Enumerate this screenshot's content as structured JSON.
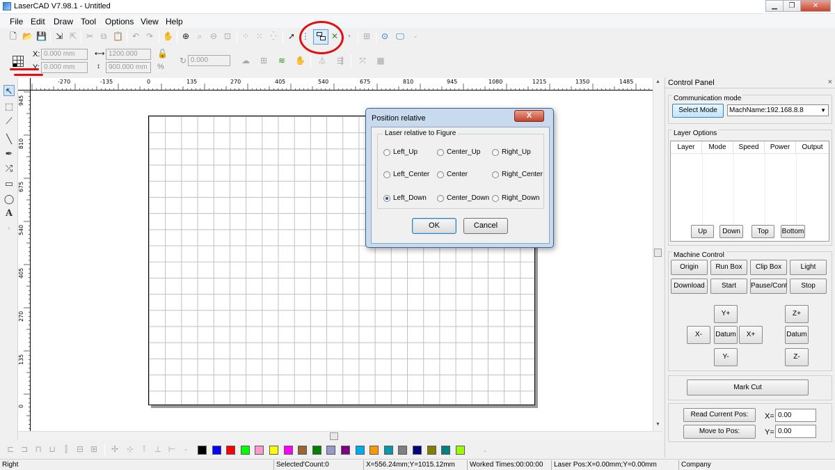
{
  "window": {
    "title": "LaserCAD V7.98.1 - Untitled"
  },
  "menu": [
    {
      "label": "File",
      "key": "F"
    },
    {
      "label": "Edit",
      "key": "E"
    },
    {
      "label": "Draw",
      "key": "D"
    },
    {
      "label": "Tool",
      "key": "T"
    },
    {
      "label": "Options",
      "key": "O"
    },
    {
      "label": "View",
      "key": "V"
    },
    {
      "label": "Help",
      "key": "H"
    }
  ],
  "coords": {
    "x_label": "X:",
    "y_label": "Y:",
    "x_value": "0.000 mm",
    "y_value": "0.000 mm",
    "width_value": "1200.000 mm",
    "height_value": "900.000 mm",
    "rotate_value": "0.000",
    "percent_symbol": "%"
  },
  "ruler": {
    "horizontal": [
      "-270",
      "-135",
      "0",
      "135",
      "270",
      "405",
      "540",
      "675",
      "810",
      "945",
      "1080",
      "1215",
      "1350",
      "1485"
    ],
    "vertical": [
      "945",
      "810",
      "675",
      "540",
      "405",
      "270",
      "135",
      "0"
    ]
  },
  "dialog": {
    "title": "Position relative",
    "close": "X",
    "group_label": "Laser relative to Figure",
    "options": [
      {
        "label": "Left_Up",
        "selected": false
      },
      {
        "label": "Center_Up",
        "selected": false
      },
      {
        "label": "Right_Up",
        "selected": false
      },
      {
        "label": "Left_Center",
        "selected": false
      },
      {
        "label": "Center",
        "selected": false
      },
      {
        "label": "Right_Center",
        "selected": false
      },
      {
        "label": "Left_Down",
        "selected": true
      },
      {
        "label": "Center_Down",
        "selected": false
      },
      {
        "label": "Right_Down",
        "selected": false
      }
    ],
    "ok": "OK",
    "cancel": "Cancel"
  },
  "control_panel": {
    "title": "Control Panel",
    "close": "×",
    "comm_label": "Communication mode",
    "select_mode": "Select Mode",
    "machine_name": "MachName:192.168.8.8",
    "layer_label": "Layer Options",
    "layer_columns": [
      "Layer",
      "Mode",
      "Speed",
      "Power",
      "Output"
    ],
    "layer_buttons": [
      "Up",
      "Down",
      "Top",
      "Bottom"
    ],
    "machine_label": "Machine Control",
    "machine_row1": [
      "Origin",
      "Run Box",
      "Clip Box",
      "Light"
    ],
    "machine_row2": [
      "Download",
      "Start",
      "Pause/Continue",
      "Stop"
    ],
    "jog": {
      "y_plus": "Y+",
      "x_minus": "X-",
      "datum": "Datum",
      "x_plus": "X+",
      "y_minus": "Y-",
      "z_plus": "Z+",
      "z_datum": "Datum",
      "z_minus": "Z-"
    },
    "mark_cut": "Mark Cut",
    "read_pos": "Read Current Pos:",
    "move_pos": "Move to Pos:",
    "x_label": "X=",
    "y_label": "Y=",
    "x_value": "0.00",
    "y_value": "0.00"
  },
  "palette": [
    "#000000",
    "#0000ff",
    "#ff0000",
    "#00ff00",
    "#ff99cc",
    "#ffff00",
    "#ff00ff",
    "#996633",
    "#008000",
    "#9999cc",
    "#800080",
    "#00aaee",
    "#ff9900",
    "#0099aa",
    "#808080",
    "#000080",
    "#808000",
    "#008080",
    "#99ff00"
  ],
  "status": {
    "mode": "Right",
    "selected": "Selected'Count:0",
    "cursor": "X=556.24mm;Y=1015.12mm",
    "worked": "Worked Times:00:00:00",
    "laser_pos": "Laser Pos:X=0.00mm;Y=0.00mm",
    "company": "Company"
  }
}
